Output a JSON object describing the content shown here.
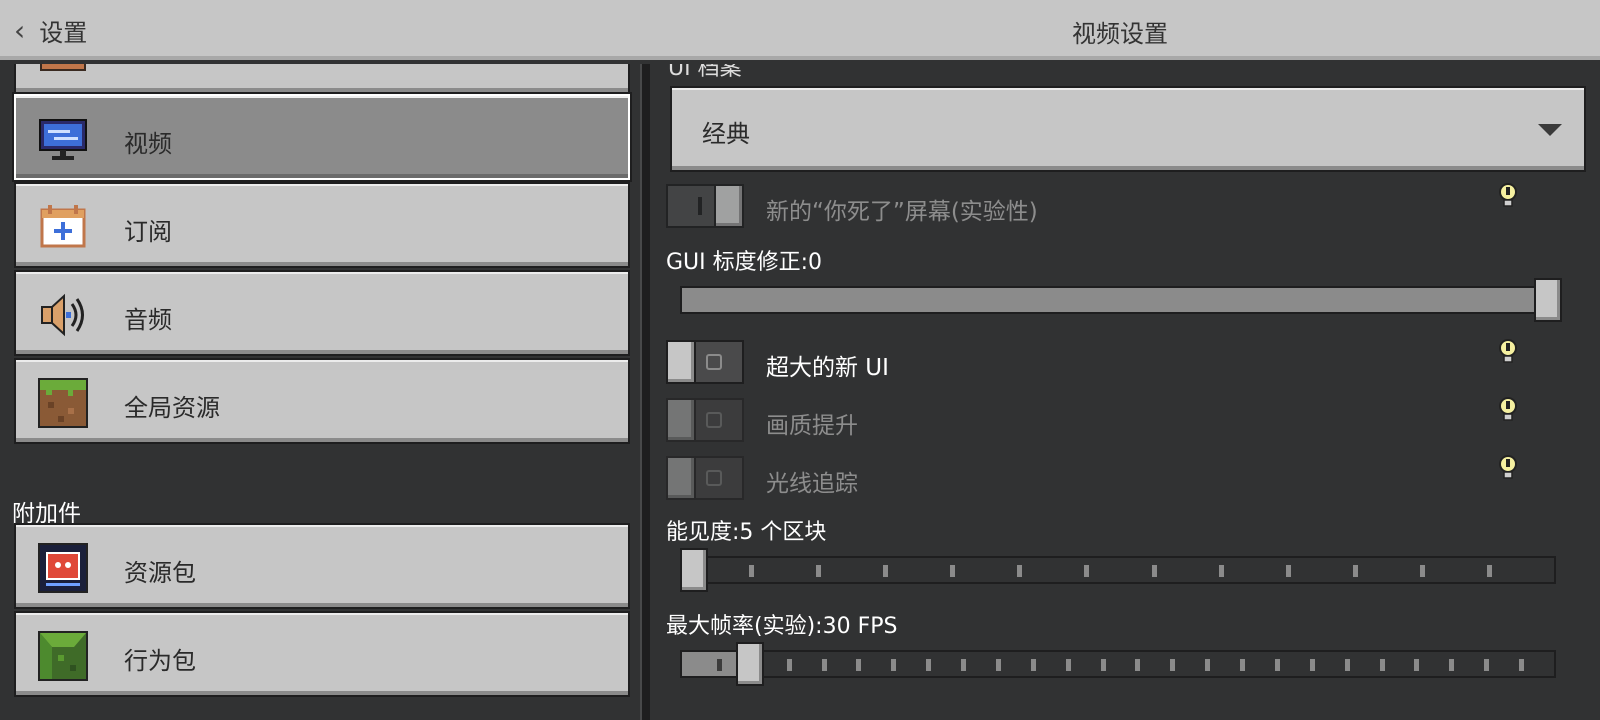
{
  "header": {
    "back_label": "设置",
    "title": "视频设置"
  },
  "sidebar": {
    "items": [
      {
        "label": "视频",
        "icon": "monitor-icon",
        "active": true
      },
      {
        "label": "订阅",
        "icon": "calendar-plus-icon",
        "active": false
      },
      {
        "label": "音频",
        "icon": "speaker-icon",
        "active": false
      },
      {
        "label": "全局资源",
        "icon": "grass-block-icon",
        "active": false
      }
    ],
    "section_addons": "附加件",
    "addon_items": [
      {
        "label": "资源包",
        "icon": "resource-pack-icon"
      },
      {
        "label": "行为包",
        "icon": "behavior-pack-icon"
      }
    ]
  },
  "settings": {
    "partial_label": "UI 档案",
    "ui_profile": {
      "value": "经典"
    },
    "new_death_screen": {
      "label": "新的“你死了”屏幕(实验性)",
      "on": true,
      "enabled": false
    },
    "gui_scale": {
      "label": "GUI 标度修正:0",
      "value": 0,
      "position": 1.0
    },
    "large_new_ui": {
      "label": "超大的新 UI",
      "on": false,
      "enabled": true
    },
    "upscaling": {
      "label": "画质提升",
      "on": false,
      "enabled": false
    },
    "ray_tracing": {
      "label": "光线追踪",
      "on": false,
      "enabled": false
    },
    "render_distance": {
      "label": "能见度:5 个区块",
      "chunks": 5,
      "position": 0.0,
      "ticks": 12
    },
    "max_framerate": {
      "label": "最大帧率(实验):30 FPS",
      "fps": 30,
      "position": 0.08,
      "ticks": 24
    }
  },
  "colors": {
    "panel": "#c6c6c6",
    "background": "#313233",
    "accent_blue": "#3d6fd9"
  }
}
